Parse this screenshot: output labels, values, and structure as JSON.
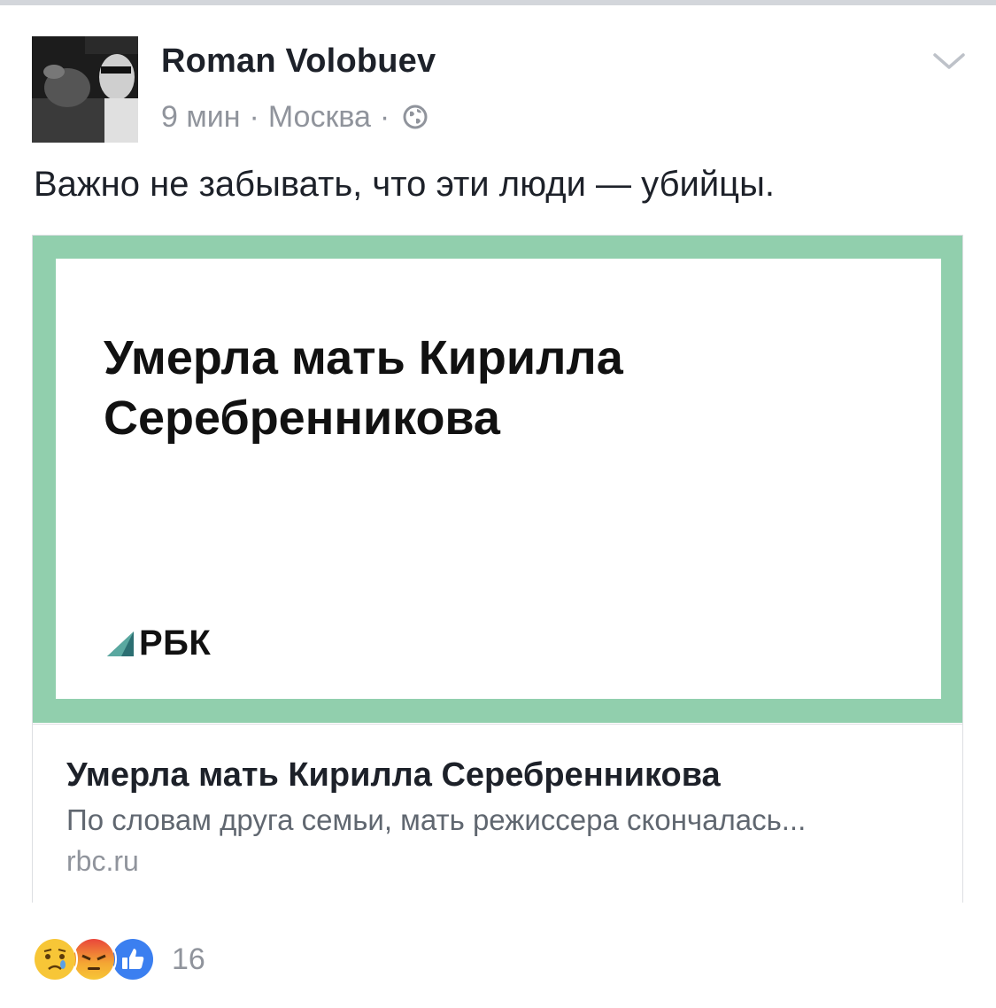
{
  "post": {
    "author": "Roman Volobuev",
    "time": "9 мин",
    "separator": "·",
    "location": "Москва",
    "privacy_icon": "globe-icon",
    "menu_icon": "chevron-down-icon",
    "text": "Важно не забывать, что эти люди — убийцы."
  },
  "link_preview": {
    "image_headline": "Умерла мать Кирилла Серебренникова",
    "logo_text": "РБК",
    "frame_color": "#91cfad",
    "title": "Умерла мать Кирилла Серебренникова",
    "description": "По словам друга семьи, мать режиссера скончалась...",
    "domain": "rbc.ru"
  },
  "reactions": {
    "icons": [
      "sad-reaction-icon",
      "angry-reaction-icon",
      "like-reaction-icon"
    ],
    "count": "16"
  }
}
